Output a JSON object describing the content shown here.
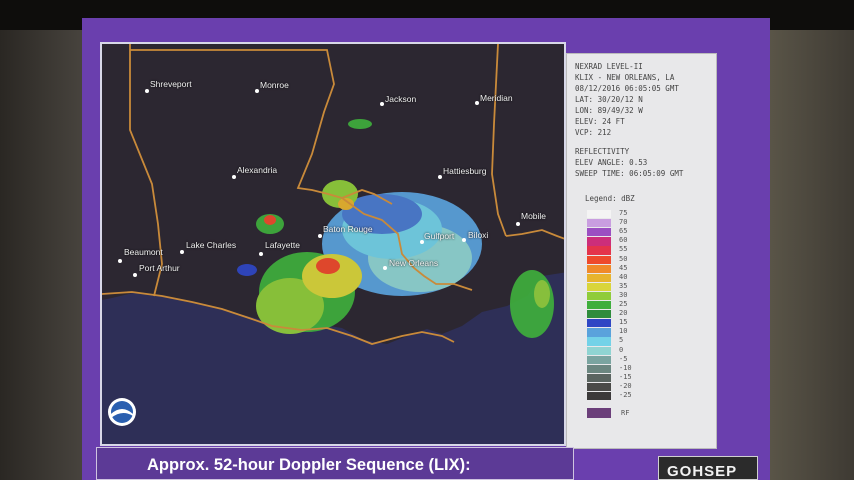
{
  "radar_info": {
    "line1": "NEXRAD LEVEL-II",
    "line2": "KLIX - NEW ORLEANS, LA",
    "line3": "08/12/2016 06:05:05 GMT",
    "line4": "LAT: 30/20/12 N",
    "line5": "LON: 89/49/32 W",
    "line6": "ELEV: 24 FT",
    "line7": "VCP: 212",
    "line8": "REFLECTIVITY",
    "line9": "ELEV ANGLE: 0.53",
    "line10": "SWEEP TIME: 06:05:09 GMT"
  },
  "legend": {
    "title": "Legend: dBZ",
    "ticks": [
      "75",
      "70",
      "65",
      "60",
      "55",
      "50",
      "45",
      "40",
      "35",
      "30",
      "25",
      "20",
      "15",
      "10",
      "5",
      "0",
      "-5",
      "-10",
      "-15",
      "-20",
      "-25"
    ],
    "colors": [
      "#f4f4f4",
      "#c99ee0",
      "#9b4fc2",
      "#cc2e7a",
      "#e4334b",
      "#ee4a2c",
      "#f08a2a",
      "#e7b42e",
      "#d9d53a",
      "#8fcc3a",
      "#3fae3c",
      "#2f8c3c",
      "#2f46c4",
      "#5aa2dc",
      "#73d2e8",
      "#8fd4d2",
      "#7aa4a0",
      "#6b8680",
      "#5a6460",
      "#4a4a48",
      "#3c3a3a"
    ],
    "rf_label": "RF",
    "rf_color": "#6b3f7a"
  },
  "cities": {
    "shreveport": "Shreveport",
    "monroe": "Monroe",
    "jackson": "Jackson",
    "meridian": "Meridian",
    "alexandria": "Alexandria",
    "hattiesburg": "Hattiesburg",
    "mobile": "Mobile",
    "baton_rouge": "Baton Rouge",
    "gulfport": "Gulfport",
    "biloxi": "Biloxi",
    "beaumont": "Beaumont",
    "lake_charles": "Lake Charles",
    "lafayette": "Lafayette",
    "port_arthur": "Port Arthur",
    "new_orleans": "New Orleans"
  },
  "caption": {
    "title": "Approx. 52-hour Doppler Sequence (LIX):"
  },
  "logo": {
    "text": "GOHSEP"
  },
  "colors": {
    "slide_bg": "#6a3fae",
    "land": "#2f2a36",
    "water": "#2e2f57",
    "state_border": "#c98a3a"
  }
}
